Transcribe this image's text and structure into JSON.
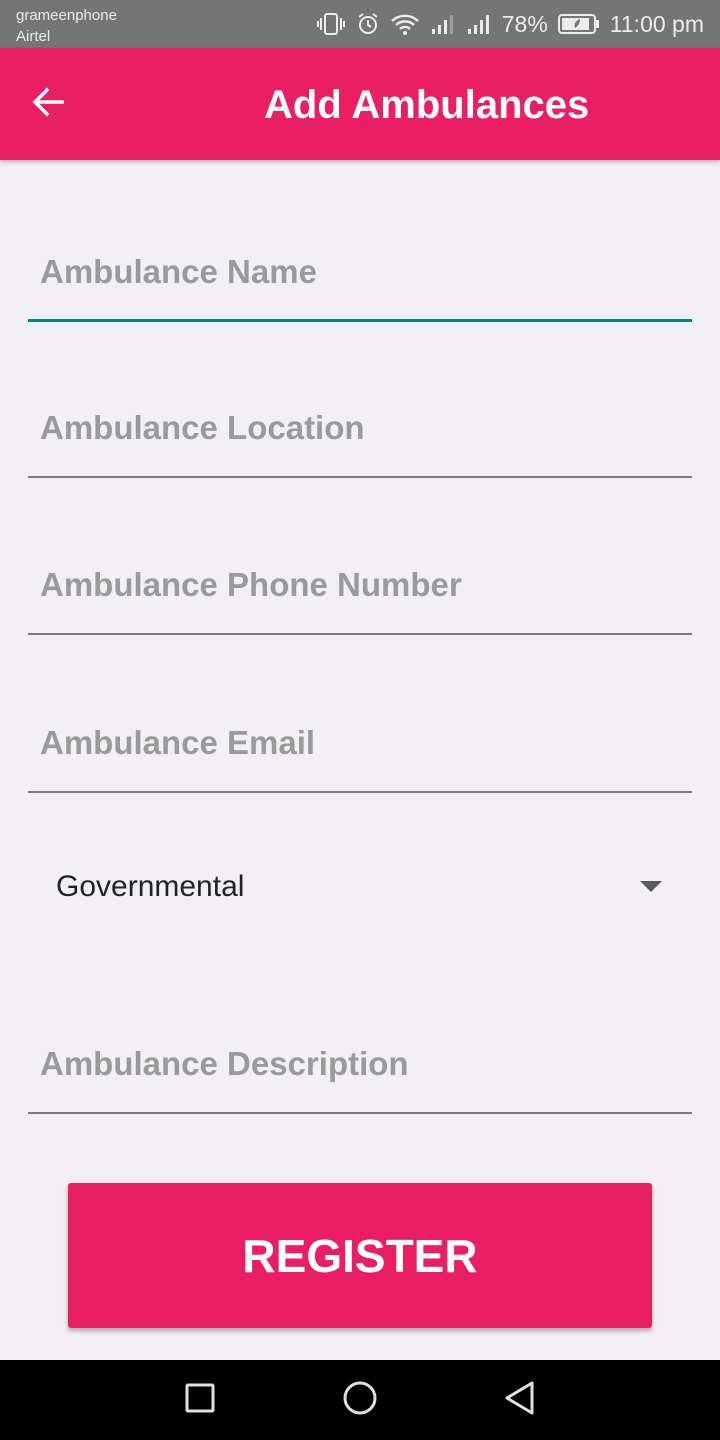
{
  "status_bar": {
    "carrier_1": "grameenphone",
    "carrier_2": "Airtel",
    "battery": "78%",
    "time": "11:00 pm",
    "icons": [
      "vibrate-icon",
      "alarm-icon",
      "wifi-icon",
      "signal-icon",
      "signal-icon",
      "battery-charging-icon"
    ]
  },
  "app_bar": {
    "title": "Add Ambulances",
    "back_icon": "arrow-back-icon",
    "color": "#e91e63"
  },
  "form": {
    "name_placeholder": "Ambulance Name",
    "location_placeholder": "Ambulance Location",
    "phone_placeholder": "Ambulance Phone Number",
    "email_placeholder": "Ambulance Email",
    "type_selected": "Governmental",
    "description_placeholder": "Ambulance Description",
    "focus_color": "#00897b"
  },
  "register_button": {
    "label": "REGISTER",
    "color": "#e91e63"
  },
  "nav_bar": {
    "icons": [
      "recent-apps-icon",
      "home-icon",
      "back-icon"
    ]
  }
}
